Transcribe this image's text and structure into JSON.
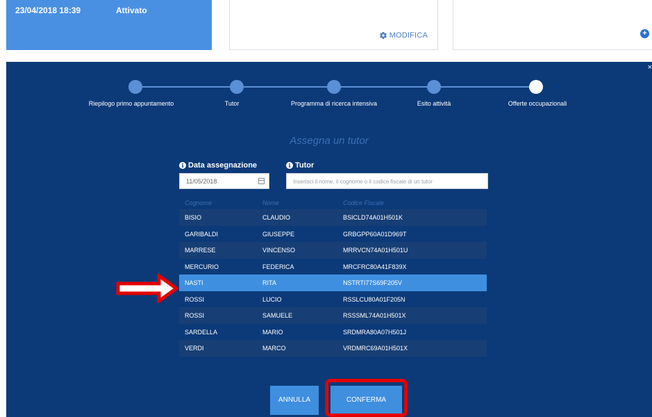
{
  "top": {
    "date": "23/04/2018 18:39",
    "status": "Attivato",
    "modifica_label": "MODIFICA",
    "plus_symbol": "+"
  },
  "modal": {
    "close_symbol": "×",
    "steps": [
      {
        "label": "Riepilogo primo appuntamento",
        "active": false
      },
      {
        "label": "Tutor",
        "active": false
      },
      {
        "label": "Programma di ricerca intensiva",
        "active": false
      },
      {
        "label": "Esito attività",
        "active": false
      },
      {
        "label": "Offerte occupazionali",
        "active": true
      }
    ],
    "title": "Assegna un tutor",
    "date_label": "Data assegnazione",
    "date_value": "11/05/2018",
    "tutor_label": "Tutor",
    "tutor_placeholder": "Inserisci il nome, il cognome o il codice fiscale di un tutor",
    "info_symbol": "i",
    "table": {
      "headers": [
        "Cognome",
        "Nome",
        "Codice Fiscale"
      ],
      "rows": [
        [
          "BISIO",
          "CLAUDIO",
          "BSICLD74A01H501K"
        ],
        [
          "GARIBALDI",
          "GIUSEPPE",
          "GRBGPP60A01D969T"
        ],
        [
          "MARRESE",
          "VINCENSO",
          "MRRVCN74A01H501U"
        ],
        [
          "MERCURIO",
          "FEDERICA",
          "MRCFRC80A41F839X"
        ],
        [
          "NASTI",
          "RITA",
          "NSTRTI77S69F205V"
        ],
        [
          "ROSSI",
          "LUCIO",
          "RSSLCU80A01F205N"
        ],
        [
          "ROSSI",
          "SAMUELE",
          "RSSSML74A01H501X"
        ],
        [
          "SARDELLA",
          "MARIO",
          "SRDMRA80A07H501J"
        ],
        [
          "VERDI",
          "MARCO",
          "VRDMRC69A01H501X"
        ]
      ],
      "selected_index": 4
    },
    "cancel_label": "ANNULLA",
    "confirm_label": "CONFERMA"
  },
  "colors": {
    "modal_bg": "#0c3a78",
    "accent": "#3f8fe0",
    "highlight": "#e30000"
  }
}
